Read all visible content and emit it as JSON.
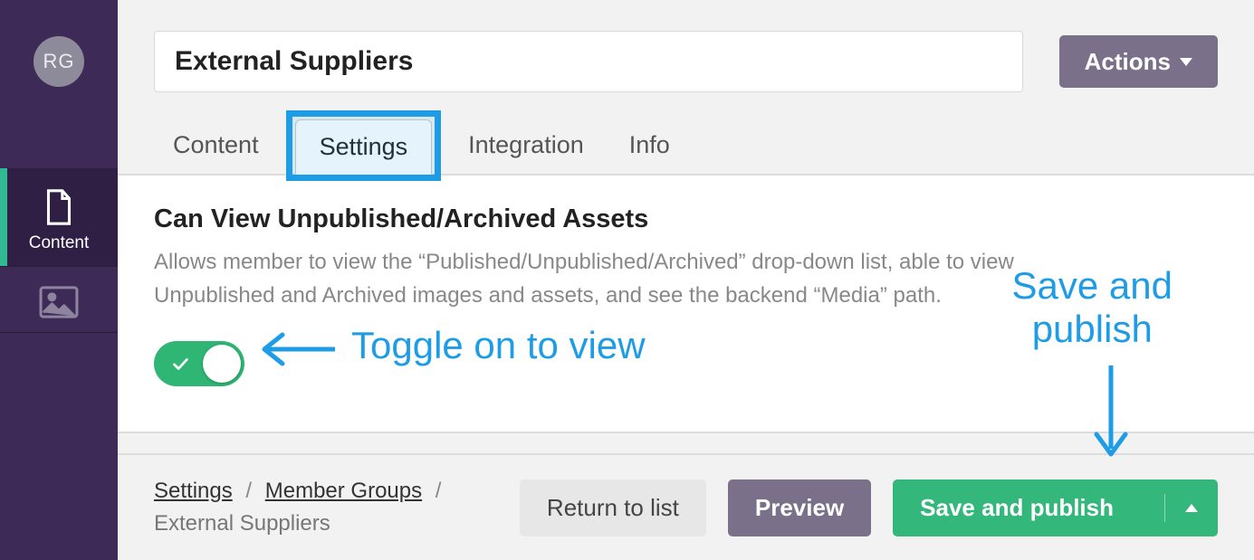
{
  "sidebar": {
    "avatar": "RG",
    "items": [
      {
        "label": "Content"
      }
    ]
  },
  "header": {
    "title": "External Suppliers",
    "actions_label": "Actions"
  },
  "tabs": [
    {
      "label": "Content"
    },
    {
      "label": "Settings"
    },
    {
      "label": "Integration"
    },
    {
      "label": "Info"
    }
  ],
  "setting": {
    "title": "Can View Unpublished/Archived Assets",
    "description": "Allows member to view the “Published/Unpublished/Archived” drop-down list, able to view Unpublished and Archived images and assets, and see the backend “Media” path."
  },
  "annotations": {
    "toggle": "Toggle on to view",
    "save_line1": "Save and",
    "save_line2": "publish"
  },
  "breadcrumb": {
    "a": "Settings",
    "b": "Member Groups",
    "sep": "/",
    "current": "External Suppliers"
  },
  "footer": {
    "return": "Return to list",
    "preview": "Preview",
    "publish": "Save and publish"
  }
}
